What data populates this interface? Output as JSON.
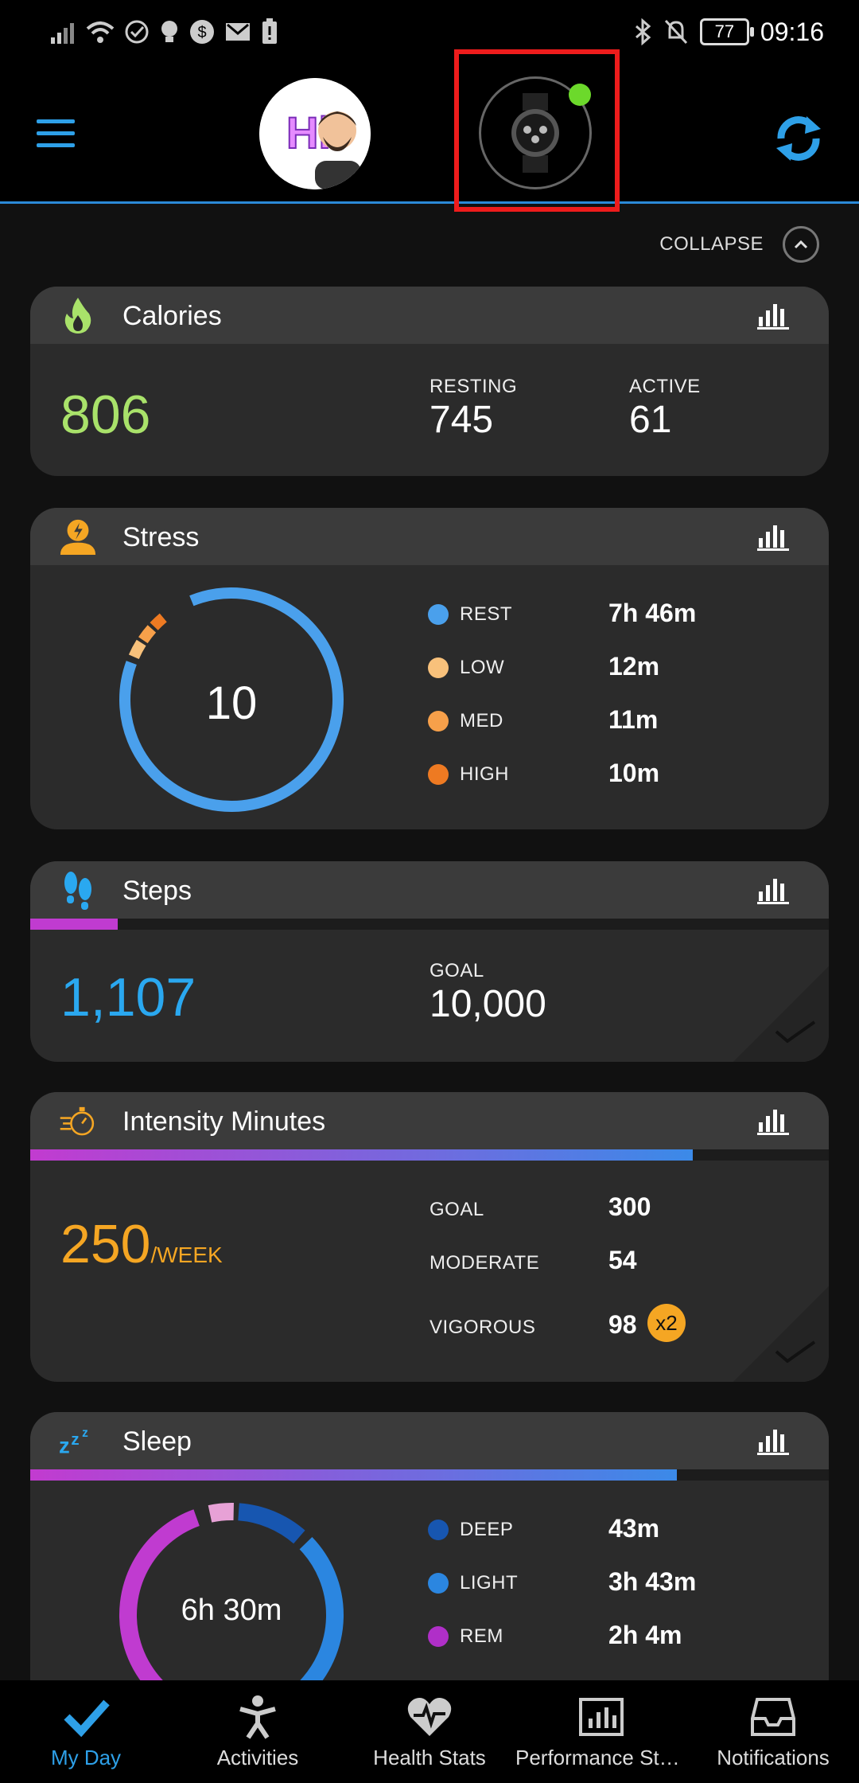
{
  "status_bar": {
    "time": "09:16",
    "battery": "77",
    "left_icons": [
      "signal-icon",
      "wifi-icon",
      "check-circle-icon",
      "bulb-icon",
      "dollar-icon",
      "mail-icon",
      "battery-alert-icon"
    ],
    "right_icons": [
      "bluetooth-icon",
      "bell-off-icon"
    ]
  },
  "header": {
    "avatar_text": "Hi",
    "device_connected": true
  },
  "collapse_label": "COLLAPSE",
  "calories": {
    "title": "Calories",
    "total": "806",
    "resting_label": "RESTING",
    "resting": "745",
    "active_label": "ACTIVE",
    "active": "61"
  },
  "stress": {
    "title": "Stress",
    "level": "10",
    "items": [
      {
        "label": "REST",
        "value": "7h 46m",
        "color": "#4aa0ec"
      },
      {
        "label": "LOW",
        "value": "12m",
        "color": "#f8c17b"
      },
      {
        "label": "MED",
        "value": "11m",
        "color": "#f7a04a"
      },
      {
        "label": "HIGH",
        "value": "10m",
        "color": "#ee7a22"
      }
    ]
  },
  "steps": {
    "title": "Steps",
    "value": "1,107",
    "goal_label": "GOAL",
    "goal": "10,000",
    "progress": 0.11
  },
  "intensity": {
    "title": "Intensity Minutes",
    "value": "250",
    "unit": "/WEEK",
    "progress": 0.83,
    "goal_label": "GOAL",
    "goal": "300",
    "moderate_label": "MODERATE",
    "moderate": "54",
    "vigorous_label": "VIGOROUS",
    "vigorous": "98",
    "vigorous_badge": "x2"
  },
  "sleep": {
    "title": "Sleep",
    "total": "6h 30m",
    "progress": 0.81,
    "items": [
      {
        "label": "DEEP",
        "value": "43m",
        "color": "#1756b0"
      },
      {
        "label": "LIGHT",
        "value": "3h 43m",
        "color": "#2b86e0"
      },
      {
        "label": "REM",
        "value": "2h 4m",
        "color": "#b02fc8"
      }
    ]
  },
  "nav": [
    {
      "label": "My Day",
      "active": true
    },
    {
      "label": "Activities",
      "active": false
    },
    {
      "label": "Health Stats",
      "active": false
    },
    {
      "label": "Performance Sta...",
      "active": false
    },
    {
      "label": "Notifications",
      "active": false
    }
  ],
  "colors": {
    "accent": "#2ea0e8",
    "calories": "#a9e26a",
    "steps": "#2aa8f0",
    "intensity": "#f5a623"
  }
}
